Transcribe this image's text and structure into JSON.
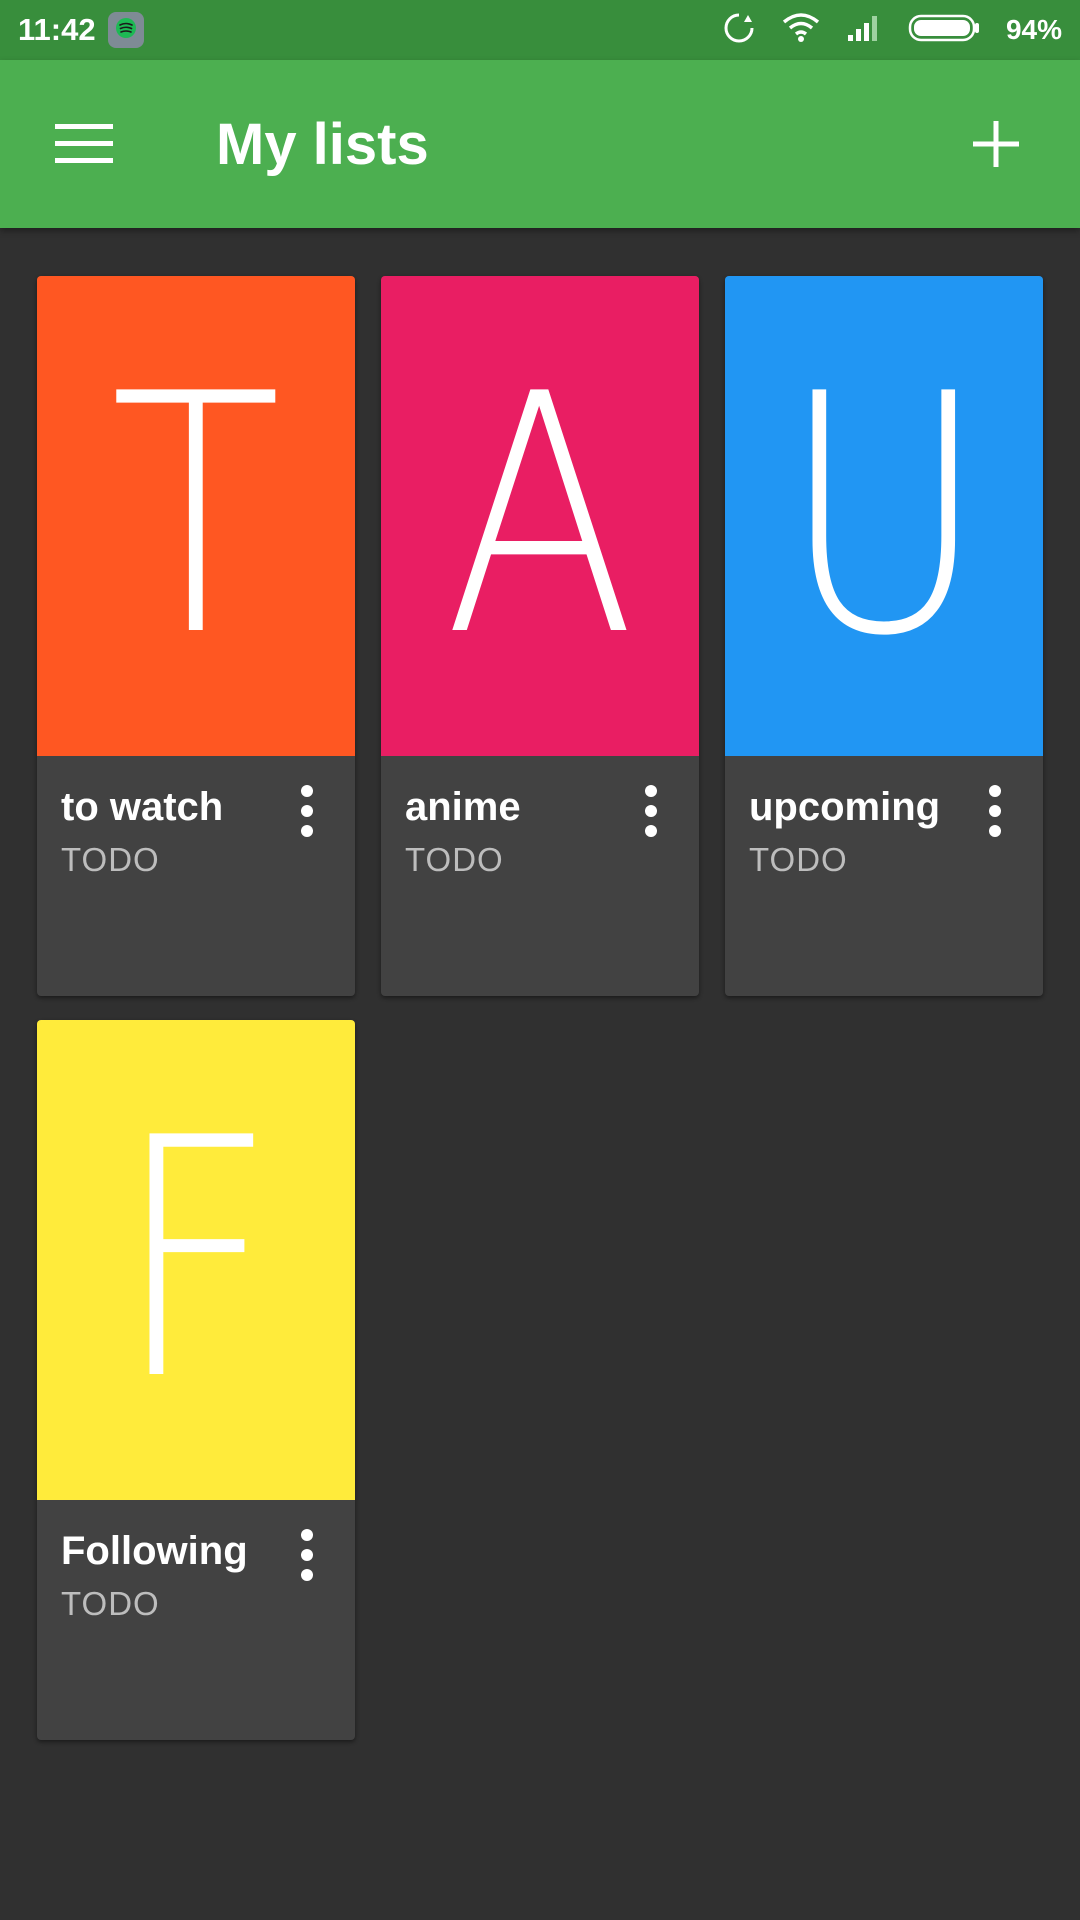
{
  "status_bar": {
    "time": "11:42",
    "battery": "94%",
    "icons": [
      "spotify-notification-icon",
      "sync-icon",
      "wifi-icon",
      "signal-icon",
      "battery-icon"
    ]
  },
  "app_bar": {
    "title": "My lists",
    "menu_icon": "hamburger-menu-icon",
    "add_icon": "plus-icon",
    "color": "#4caf50",
    "status_color": "#388e3c"
  },
  "lists": [
    {
      "letter": "T",
      "name": "to watch",
      "subtitle": "TODO",
      "color": "#ff5722"
    },
    {
      "letter": "A",
      "name": "anime",
      "subtitle": "TODO",
      "color": "#e91e63"
    },
    {
      "letter": "U",
      "name": "upcoming",
      "subtitle": "TODO",
      "color": "#2196f3"
    },
    {
      "letter": "F",
      "name": "Following",
      "subtitle": "TODO",
      "color": "#ffeb3b"
    }
  ]
}
